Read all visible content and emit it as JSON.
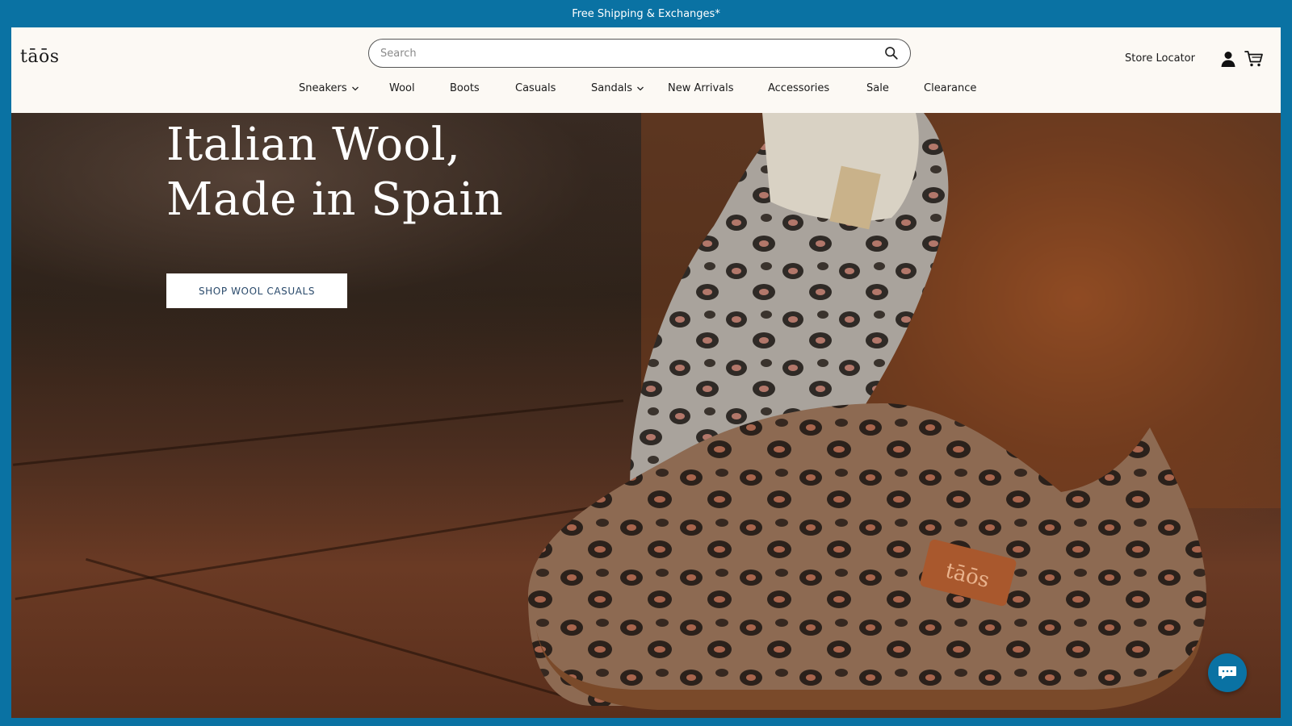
{
  "announcement": {
    "text": "Free Shipping & Exchanges*"
  },
  "header": {
    "logo_text": "tāōs",
    "search": {
      "placeholder": "Search",
      "value": ""
    },
    "store_locator": "Store Locator",
    "icons": {
      "search": "search-icon",
      "account": "user-icon",
      "cart": "cart-icon"
    }
  },
  "nav": {
    "items": [
      {
        "label": "Sneakers",
        "has_dropdown": true
      },
      {
        "label": "Wool",
        "has_dropdown": false
      },
      {
        "label": "Boots",
        "has_dropdown": false
      },
      {
        "label": "Casuals",
        "has_dropdown": false
      },
      {
        "label": "Sandals",
        "has_dropdown": true
      },
      {
        "label": "New Arrivals",
        "has_dropdown": false
      },
      {
        "label": "Accessories",
        "has_dropdown": false
      },
      {
        "label": "Sale",
        "has_dropdown": false
      },
      {
        "label": "Clearance",
        "has_dropdown": false
      }
    ]
  },
  "hero": {
    "title_line1": "Italian Wool,",
    "title_line2": "Made in Spain",
    "cta_label": "SHOP WOOL CASUALS",
    "shoe_badge": "tāōs"
  },
  "chat": {
    "icon": "chat-bubble-icon"
  },
  "colors": {
    "frame": "#0a72a3",
    "header_bg": "#fcf9f4",
    "cta_text": "#2a4a6b"
  }
}
